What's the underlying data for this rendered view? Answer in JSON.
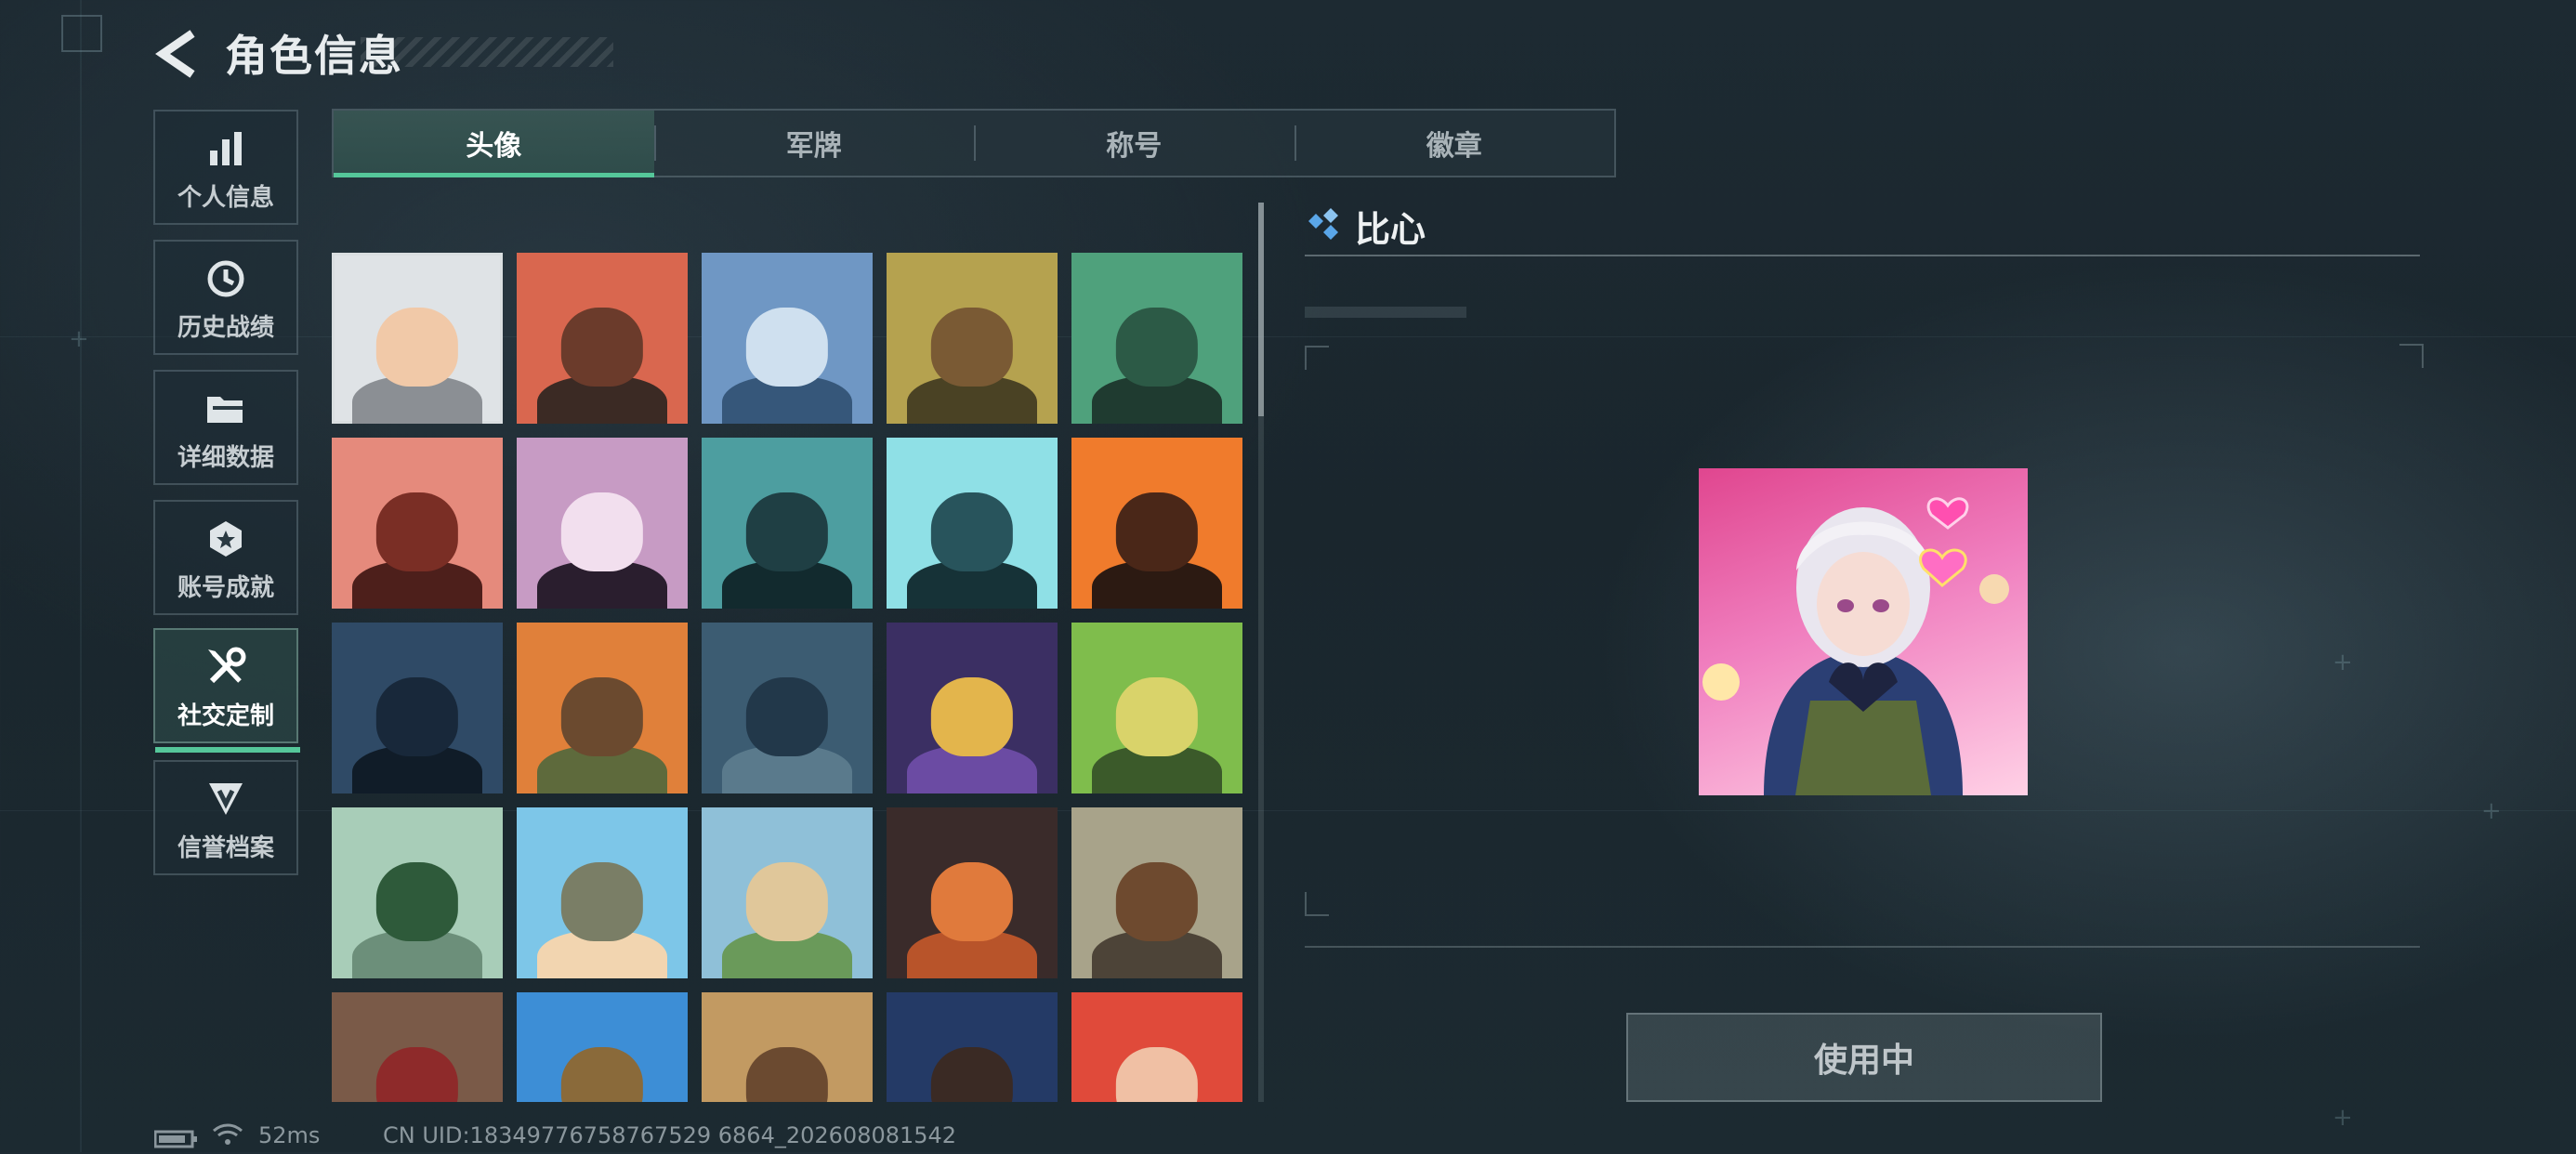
{
  "header": {
    "title": "角色信息"
  },
  "sidebar": {
    "items": [
      {
        "label": "个人信息",
        "icon": "bar-chart-icon"
      },
      {
        "label": "历史战绩",
        "icon": "history-clock-icon"
      },
      {
        "label": "详细数据",
        "icon": "folder-icon"
      },
      {
        "label": "账号成就",
        "icon": "achievement-medal-icon"
      },
      {
        "label": "社交定制",
        "icon": "tools-icon",
        "active": true
      },
      {
        "label": "信誉档案",
        "icon": "reputation-shield-icon"
      }
    ]
  },
  "tabs": [
    {
      "label": "头像",
      "active": true
    },
    {
      "label": "军牌"
    },
    {
      "label": "称号"
    },
    {
      "label": "徽章"
    }
  ],
  "avatars": [
    {
      "name": "avatar-photo-portrait",
      "bg": "#dfe3e6",
      "head": "#f1c9a8",
      "body": "#8b8f94",
      "selected": true
    },
    {
      "name": "avatar-cap-soldier",
      "bg": "#d9674f",
      "head": "#6b3b2b",
      "body": "#3b2a24"
    },
    {
      "name": "avatar-pilot-woman",
      "bg": "#6f97c4",
      "head": "#cfe0ef",
      "body": "#36577a"
    },
    {
      "name": "avatar-bald-operator",
      "bg": "#b5a24f",
      "head": "#7a5a34",
      "body": "#4a4224"
    },
    {
      "name": "avatar-green-operator",
      "bg": "#4fa17c",
      "head": "#2c5a46",
      "body": "#1f3b30"
    },
    {
      "name": "avatar-helmet-woman",
      "bg": "#e58a7c",
      "head": "#7a2e25",
      "body": "#4d1f1b"
    },
    {
      "name": "avatar-white-hair-woman",
      "bg": "#c79bc4",
      "head": "#f2dfee",
      "body": "#2a1e2e"
    },
    {
      "name": "avatar-glasses-man",
      "bg": "#4d9ea0",
      "head": "#1f3f44",
      "body": "#122a2e"
    },
    {
      "name": "avatar-masked-helmet",
      "bg": "#8fe0e6",
      "head": "#28545c",
      "body": "#163237"
    },
    {
      "name": "avatar-masked-longhair",
      "bg": "#f07b2c",
      "head": "#4a2718",
      "body": "#2c1a12"
    },
    {
      "name": "avatar-night-soldier",
      "bg": "#2f4a66",
      "head": "#18283a",
      "body": "#101c28"
    },
    {
      "name": "avatar-heavy-gunner",
      "bg": "#e0803a",
      "head": "#6b4a2f",
      "body": "#5e6a3c"
    },
    {
      "name": "avatar-sniper-scope",
      "bg": "#3c5c72",
      "head": "#22384a",
      "body": "#5a7a8c"
    },
    {
      "name": "avatar-card-hand",
      "bg": "#3b2f63",
      "head": "#e3b54c",
      "body": "#6b4ba3"
    },
    {
      "name": "avatar-exit-door",
      "bg": "#7fbd4c",
      "head": "#d9d36a",
      "body": "#3b5a2a"
    },
    {
      "name": "avatar-way-out-sign",
      "bg": "#a8cdb8",
      "head": "#2e5a3a",
      "body": "#6c8f7a"
    },
    {
      "name": "avatar-chibi-soldier",
      "bg": "#7dc6e8",
      "head": "#7a7e66",
      "body": "#f2d5b0"
    },
    {
      "name": "avatar-villa",
      "bg": "#8fc0d8",
      "head": "#e0c79a",
      "body": "#6a9a5a"
    },
    {
      "name": "avatar-feather",
      "bg": "#3a2b2a",
      "head": "#e07a3c",
      "body": "#b8542a"
    },
    {
      "name": "avatar-rusty-truck",
      "bg": "#a8a38a",
      "head": "#6e4a2f",
      "body": "#4d4438"
    },
    {
      "name": "avatar-scales-emblem",
      "bg": "#7a5a48",
      "head": "#8e2a2a",
      "body": "#c49a6a"
    },
    {
      "name": "avatar-festival-soldier",
      "bg": "#3d8ed6",
      "head": "#8a6a3a",
      "body": "#e4b04a"
    },
    {
      "name": "avatar-desert-soldier",
      "bg": "#c29a62",
      "head": "#6b4a30",
      "body": "#4a3a26"
    },
    {
      "name": "avatar-hacker",
      "bg": "#243a66",
      "head": "#3a2a24",
      "body": "#5fa8e8"
    },
    {
      "name": "avatar-red-hair-woman",
      "bg": "#e04a3a",
      "head": "#f0c0a4",
      "body": "#7a1e1a"
    }
  ],
  "detail": {
    "title": "比心",
    "use_button": "使用中"
  },
  "status_bar": {
    "ping": "52ms",
    "uid": "CN UID:18349776758767529 6864_202608081542"
  },
  "colors": {
    "accent": "#55c79a",
    "background": "#1c2930",
    "detail_icon": "#5aa6e8"
  }
}
